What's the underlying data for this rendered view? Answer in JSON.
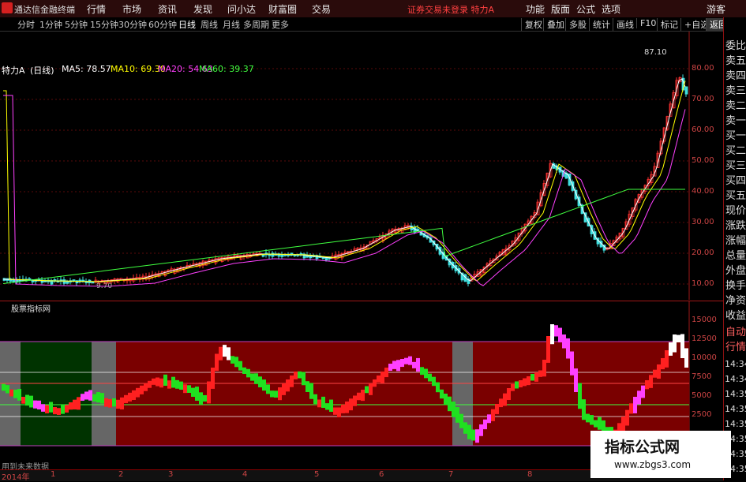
{
  "app": {
    "name": "通达信金融终端",
    "status": "证券交易未登录 特力A"
  },
  "menu": [
    "行情",
    "市场",
    "资讯",
    "发现",
    "问小达",
    "财富圈",
    "交易"
  ],
  "right_menu": [
    "功能",
    "版面",
    "公式",
    "选项",
    "游客"
  ],
  "periods": [
    "分时",
    "1分钟",
    "5分钟",
    "15分钟",
    "30分钟",
    "60分钟",
    "日线",
    "周线",
    "月线",
    "多周期",
    "更多"
  ],
  "tools": [
    "复权",
    "叠加",
    "多股",
    "统计",
    "画线",
    "F10",
    "标记",
    "+自选",
    "返回"
  ],
  "stock": {
    "name": "特力A",
    "period_label": "(日线)"
  },
  "ma": [
    {
      "label": "MA5: 78.57",
      "color": "#ffffff"
    },
    {
      "label": "MA10: 69.30",
      "color": "#ffff00"
    },
    {
      "label": "MA20: 54.63",
      "color": "#ff40ff"
    },
    {
      "label": "MA60: 39.37",
      "color": "#40ff40"
    }
  ],
  "price_axis": [
    "80.00",
    "70.00",
    "60.00",
    "50.00",
    "40.00",
    "30.00",
    "20.00",
    "10.00"
  ],
  "price_markers": {
    "high": "87.10",
    "low": "9.70"
  },
  "indicator": {
    "name": "股票指标网",
    "axis": [
      "15000",
      "12500",
      "10000",
      "7500",
      "5000",
      "2500"
    ],
    "footer": "用到未来数据"
  },
  "right_times": [
    "14:34",
    "14:34",
    "14:35",
    "14:35",
    "14:35",
    "14:35",
    "14:35",
    "14:35"
  ],
  "side_labels": [
    "委比",
    "卖五",
    "卖四",
    "卖三",
    "卖二",
    "卖一",
    "买一",
    "买二",
    "买三",
    "买四",
    "买五",
    "现价",
    "涨跌",
    "涨幅",
    "总量",
    "外盘",
    "换手",
    "净资",
    "收益",
    "自动",
    "行情"
  ],
  "bottom_axis": [
    "2014年",
    "1",
    "2",
    "3",
    "4",
    "5",
    "6",
    "7",
    "8"
  ],
  "watermark": {
    "title": "指标公式网",
    "url": "www.zbgs3.com"
  }
}
